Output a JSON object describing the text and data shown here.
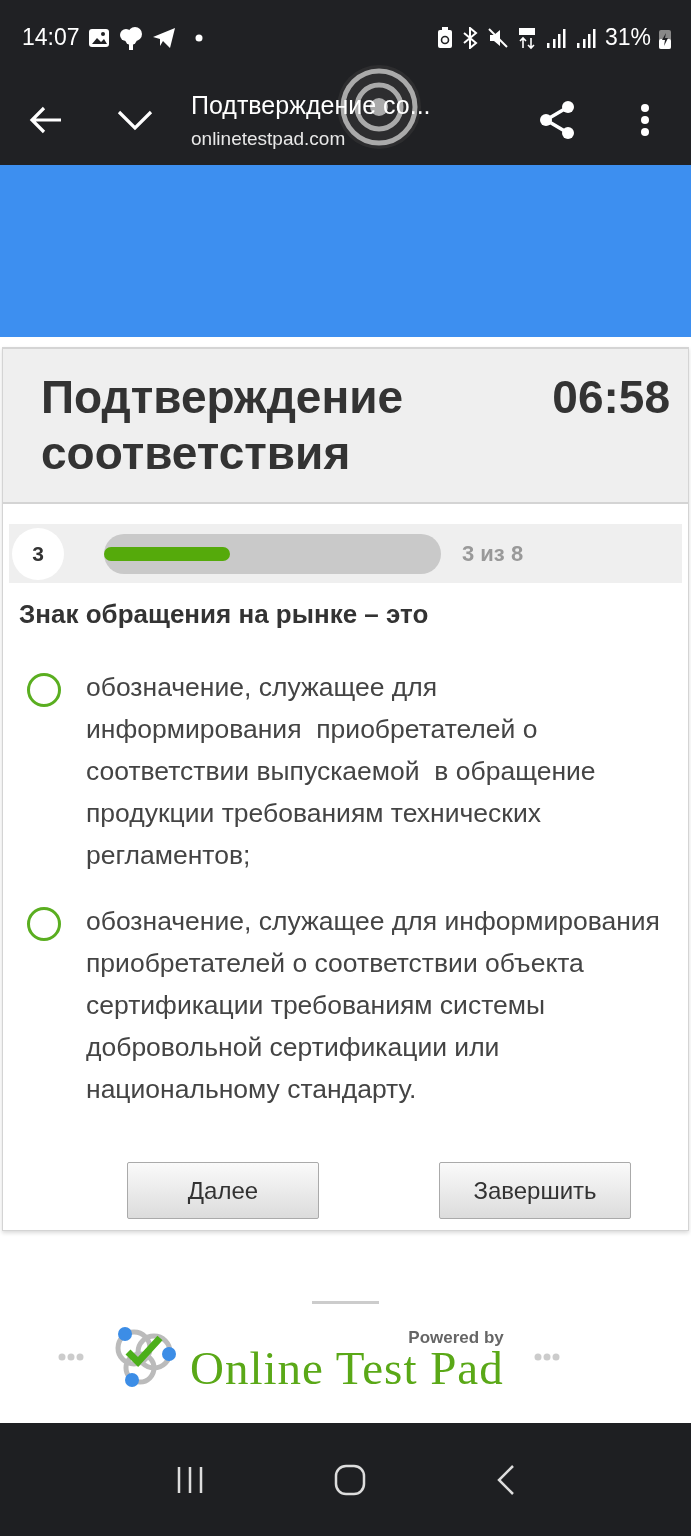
{
  "status_bar": {
    "time": "14:07",
    "battery": "31%"
  },
  "browser": {
    "title": "Подтверждение со...",
    "url": "onlinetestpad.com"
  },
  "quiz": {
    "title": "Подтверждение соответствия",
    "timer": "06:58",
    "question_number": "3",
    "progress": {
      "level": 0.375
    },
    "progress_text": "3 из 8",
    "question": "Знак обращения на рынке – это",
    "options": [
      {
        "text": "обозначение, служащее для\nинформирования  приобретателей о\nсоответствии выпускаемой  в обращение\nпродукции требованиям технических\nрегламентов;",
        "selected": false
      },
      {
        "text": "обозначение, служащее для информирования приобретателей о соответствии объекта сертификации требованиям системы добровольной сертификации или национальному стандарту.",
        "selected": false
      }
    ],
    "buttons": [
      "Далее",
      "Завершить"
    ]
  },
  "footer": {
    "powered_by": "Powered by",
    "brand": "Online Test Pad"
  }
}
